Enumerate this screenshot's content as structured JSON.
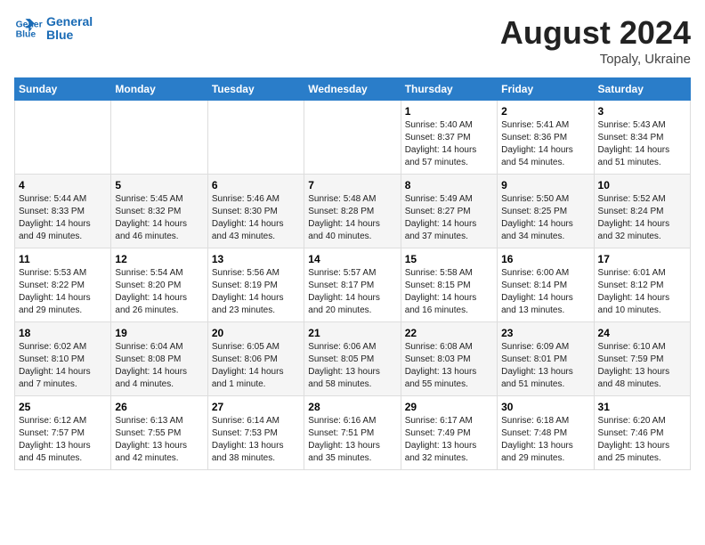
{
  "header": {
    "logo_line1": "General",
    "logo_line2": "Blue",
    "month": "August 2024",
    "location": "Topaly, Ukraine"
  },
  "weekdays": [
    "Sunday",
    "Monday",
    "Tuesday",
    "Wednesday",
    "Thursday",
    "Friday",
    "Saturday"
  ],
  "weeks": [
    [
      {
        "day": "",
        "info": ""
      },
      {
        "day": "",
        "info": ""
      },
      {
        "day": "",
        "info": ""
      },
      {
        "day": "",
        "info": ""
      },
      {
        "day": "1",
        "info": "Sunrise: 5:40 AM\nSunset: 8:37 PM\nDaylight: 14 hours\nand 57 minutes."
      },
      {
        "day": "2",
        "info": "Sunrise: 5:41 AM\nSunset: 8:36 PM\nDaylight: 14 hours\nand 54 minutes."
      },
      {
        "day": "3",
        "info": "Sunrise: 5:43 AM\nSunset: 8:34 PM\nDaylight: 14 hours\nand 51 minutes."
      }
    ],
    [
      {
        "day": "4",
        "info": "Sunrise: 5:44 AM\nSunset: 8:33 PM\nDaylight: 14 hours\nand 49 minutes."
      },
      {
        "day": "5",
        "info": "Sunrise: 5:45 AM\nSunset: 8:32 PM\nDaylight: 14 hours\nand 46 minutes."
      },
      {
        "day": "6",
        "info": "Sunrise: 5:46 AM\nSunset: 8:30 PM\nDaylight: 14 hours\nand 43 minutes."
      },
      {
        "day": "7",
        "info": "Sunrise: 5:48 AM\nSunset: 8:28 PM\nDaylight: 14 hours\nand 40 minutes."
      },
      {
        "day": "8",
        "info": "Sunrise: 5:49 AM\nSunset: 8:27 PM\nDaylight: 14 hours\nand 37 minutes."
      },
      {
        "day": "9",
        "info": "Sunrise: 5:50 AM\nSunset: 8:25 PM\nDaylight: 14 hours\nand 34 minutes."
      },
      {
        "day": "10",
        "info": "Sunrise: 5:52 AM\nSunset: 8:24 PM\nDaylight: 14 hours\nand 32 minutes."
      }
    ],
    [
      {
        "day": "11",
        "info": "Sunrise: 5:53 AM\nSunset: 8:22 PM\nDaylight: 14 hours\nand 29 minutes."
      },
      {
        "day": "12",
        "info": "Sunrise: 5:54 AM\nSunset: 8:20 PM\nDaylight: 14 hours\nand 26 minutes."
      },
      {
        "day": "13",
        "info": "Sunrise: 5:56 AM\nSunset: 8:19 PM\nDaylight: 14 hours\nand 23 minutes."
      },
      {
        "day": "14",
        "info": "Sunrise: 5:57 AM\nSunset: 8:17 PM\nDaylight: 14 hours\nand 20 minutes."
      },
      {
        "day": "15",
        "info": "Sunrise: 5:58 AM\nSunset: 8:15 PM\nDaylight: 14 hours\nand 16 minutes."
      },
      {
        "day": "16",
        "info": "Sunrise: 6:00 AM\nSunset: 8:14 PM\nDaylight: 14 hours\nand 13 minutes."
      },
      {
        "day": "17",
        "info": "Sunrise: 6:01 AM\nSunset: 8:12 PM\nDaylight: 14 hours\nand 10 minutes."
      }
    ],
    [
      {
        "day": "18",
        "info": "Sunrise: 6:02 AM\nSunset: 8:10 PM\nDaylight: 14 hours\nand 7 minutes."
      },
      {
        "day": "19",
        "info": "Sunrise: 6:04 AM\nSunset: 8:08 PM\nDaylight: 14 hours\nand 4 minutes."
      },
      {
        "day": "20",
        "info": "Sunrise: 6:05 AM\nSunset: 8:06 PM\nDaylight: 14 hours\nand 1 minute."
      },
      {
        "day": "21",
        "info": "Sunrise: 6:06 AM\nSunset: 8:05 PM\nDaylight: 13 hours\nand 58 minutes."
      },
      {
        "day": "22",
        "info": "Sunrise: 6:08 AM\nSunset: 8:03 PM\nDaylight: 13 hours\nand 55 minutes."
      },
      {
        "day": "23",
        "info": "Sunrise: 6:09 AM\nSunset: 8:01 PM\nDaylight: 13 hours\nand 51 minutes."
      },
      {
        "day": "24",
        "info": "Sunrise: 6:10 AM\nSunset: 7:59 PM\nDaylight: 13 hours\nand 48 minutes."
      }
    ],
    [
      {
        "day": "25",
        "info": "Sunrise: 6:12 AM\nSunset: 7:57 PM\nDaylight: 13 hours\nand 45 minutes."
      },
      {
        "day": "26",
        "info": "Sunrise: 6:13 AM\nSunset: 7:55 PM\nDaylight: 13 hours\nand 42 minutes."
      },
      {
        "day": "27",
        "info": "Sunrise: 6:14 AM\nSunset: 7:53 PM\nDaylight: 13 hours\nand 38 minutes."
      },
      {
        "day": "28",
        "info": "Sunrise: 6:16 AM\nSunset: 7:51 PM\nDaylight: 13 hours\nand 35 minutes."
      },
      {
        "day": "29",
        "info": "Sunrise: 6:17 AM\nSunset: 7:49 PM\nDaylight: 13 hours\nand 32 minutes."
      },
      {
        "day": "30",
        "info": "Sunrise: 6:18 AM\nSunset: 7:48 PM\nDaylight: 13 hours\nand 29 minutes."
      },
      {
        "day": "31",
        "info": "Sunrise: 6:20 AM\nSunset: 7:46 PM\nDaylight: 13 hours\nand 25 minutes."
      }
    ]
  ]
}
